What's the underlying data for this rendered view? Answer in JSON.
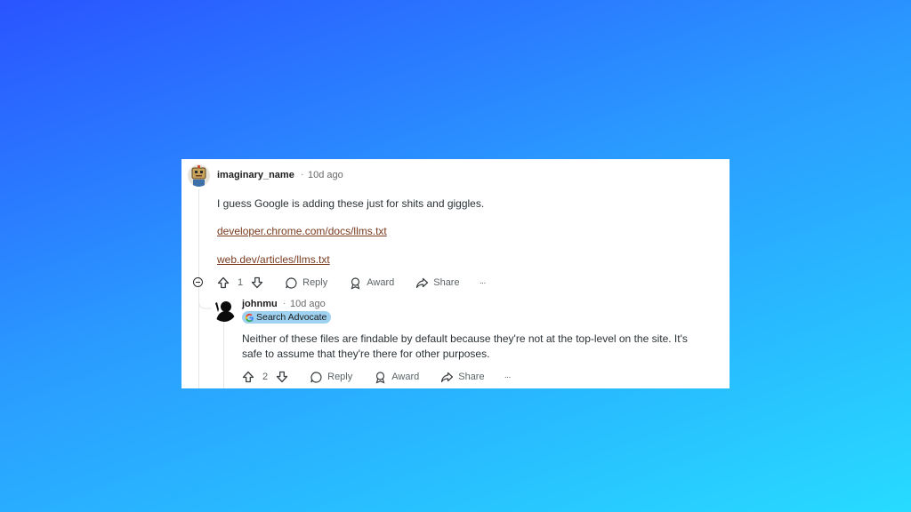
{
  "comment": {
    "username": "imaginary_name",
    "separator": "·",
    "time": "10d ago",
    "text": "I guess Google is adding these just for shits and giggles.",
    "links": [
      "developer.chrome.com/docs/llms.txt",
      "web.dev/articles/llms.txt"
    ],
    "votes": "1",
    "reply_label": "Reply",
    "award_label": "Award",
    "share_label": "Share",
    "more_label": "···"
  },
  "reply": {
    "username": "johnmu",
    "separator": "·",
    "time": "10d ago",
    "flair": "Search Advocate",
    "text_line1": "Neither of these files are findable by default because they're not at the top-level on the site. It's",
    "text_line2": "safe to assume that they're there for other purposes.",
    "votes": "2",
    "reply_label": "Reply",
    "award_label": "Award",
    "share_label": "Share",
    "more_label": "···"
  },
  "colors": {
    "link": "#7a3b1e",
    "flair_bg": "#9fd2f0",
    "meta": "#6a6a6a"
  },
  "icons": [
    "robot-avatar-icon",
    "silhouette-avatar-icon",
    "collapse-icon",
    "upvote-icon",
    "downvote-icon",
    "comment-icon",
    "award-icon",
    "share-icon",
    "more-icon",
    "google-icon"
  ]
}
